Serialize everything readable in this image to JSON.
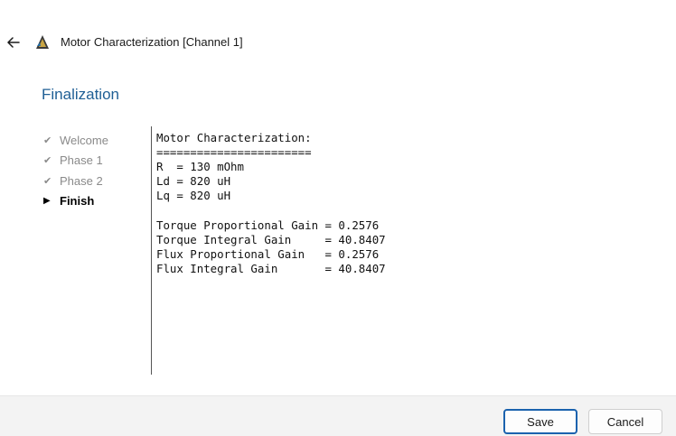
{
  "window": {
    "title": "Motor Characterization [Channel 1]",
    "back_icon": "back-arrow-icon",
    "app_icon": "app-logo-icon"
  },
  "page": {
    "heading": "Finalization"
  },
  "steps": [
    {
      "label": "Welcome",
      "state": "done"
    },
    {
      "label": "Phase 1",
      "state": "done"
    },
    {
      "label": "Phase 2",
      "state": "done"
    },
    {
      "label": "Finish",
      "state": "current"
    }
  ],
  "report": {
    "lines": [
      "Motor Characterization:",
      "=======================",
      "R  = 130 mOhm",
      "Ld = 820 uH",
      "Lq = 820 uH",
      "",
      "Torque Proportional Gain = 0.2576",
      "Torque Integral Gain     = 40.8407",
      "Flux Proportional Gain   = 0.2576",
      "Flux Integral Gain       = 40.8407"
    ]
  },
  "footer": {
    "save_label": "Save",
    "cancel_label": "Cancel"
  },
  "colors": {
    "heading": "#1f5f95",
    "primary_border": "#1b62ae",
    "footer_bg": "#f3f3f3"
  }
}
